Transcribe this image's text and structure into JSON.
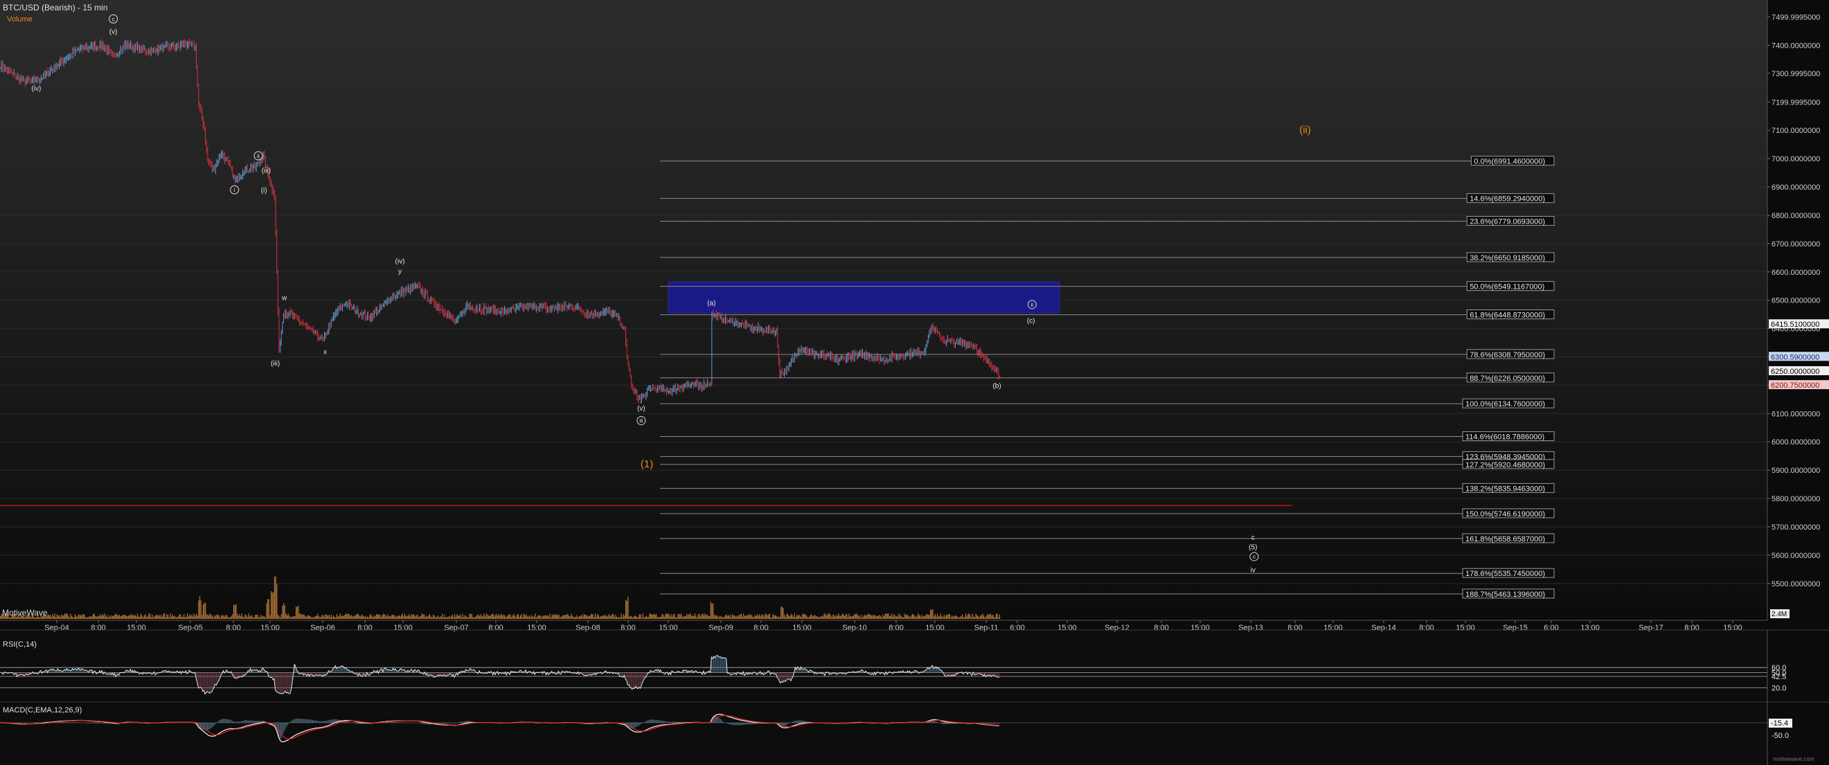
{
  "header": {
    "title": "BTC/USD (Bearish) - 15 min",
    "volume_label": "Volume"
  },
  "branding": {
    "motivewave": "MotiveWave"
  },
  "colors": {
    "background": "#0b0b0b",
    "bg_top": "#2c2c2c",
    "grid": "#2a2a2a",
    "candle_up": "#5fa3d8",
    "candle_down": "#d9323f",
    "fib_line": "#8d8d8d",
    "red_line": "#c41616",
    "box": "#1a1a8c",
    "box_border": "#2a2ab8",
    "orange": "#e8891c",
    "rsi_pos": "#4f7690",
    "rsi_neg": "#7a4450",
    "macd_line": "#e8e8e8",
    "signal_line": "#e02020"
  },
  "chart_data": {
    "type": "candlestick",
    "title": "BTC/USD (Bearish) - 15 min",
    "ylim": [
      5370,
      7560
    ],
    "price_ticks": [
      7499.9995,
      7400,
      7300.9995,
      7199.9995,
      7100,
      7000,
      6900,
      6800,
      6700,
      6600,
      6500,
      6400,
      6300,
      6200,
      6100,
      6000,
      5900,
      5800,
      5700,
      5600,
      5500
    ],
    "price_tick_labels": [
      "7499.9995000",
      "7400.0000000",
      "7300.9995000",
      "7199.9995000",
      "7100.0000000",
      "7000.0000000",
      "6900.0000000",
      "6800.0000000",
      "6700.0000000",
      "6600.0000000",
      "6500.0000000",
      "6400.0000000",
      "6300.0000000",
      "6200.0000000",
      "6100.0000000",
      "6000.0000000",
      "5900.0000000",
      "5800.0000000",
      "5700.0000000",
      "5600.0000000",
      "5500.0000000"
    ],
    "time_ticks": [
      "Sep-04",
      "8:00",
      "15:00",
      "Sep-05",
      "8:00",
      "15:00",
      "Sep-06",
      "8:00",
      "15:00",
      "Sep-07",
      "8:00",
      "15:00",
      "Sep-08",
      "8:00",
      "15:00",
      "Sep-09",
      "8:00",
      "15:00",
      "Sep-10",
      "8:00",
      "15:00",
      "Sep-11",
      "6:00",
      "15:00",
      "Sep-12",
      "8:00",
      "15:00",
      "Sep-13",
      "8:00",
      "15:00",
      "Sep-14",
      "8:00",
      "15:00",
      "Sep-15",
      "6:00",
      "13:00",
      "Sep-17",
      "8:00",
      "15:00"
    ],
    "price_anchors": [
      [
        0,
        7330
      ],
      [
        10,
        7300
      ],
      [
        22,
        7270
      ],
      [
        35,
        7280
      ],
      [
        50,
        7330
      ],
      [
        70,
        7390
      ],
      [
        90,
        7400
      ],
      [
        100,
        7360
      ],
      [
        110,
        7400
      ],
      [
        130,
        7380
      ],
      [
        150,
        7395
      ],
      [
        165,
        7405
      ],
      [
        172,
        7395
      ],
      [
        175,
        7190
      ],
      [
        180,
        7110
      ],
      [
        183,
        6990
      ],
      [
        188,
        6960
      ],
      [
        195,
        7020
      ],
      [
        202,
        6980
      ],
      [
        207,
        6920
      ],
      [
        215,
        6960
      ],
      [
        225,
        6970
      ],
      [
        232,
        7010
      ],
      [
        238,
        6920
      ],
      [
        242,
        6870
      ],
      [
        244,
        6600
      ],
      [
        246,
        6320
      ],
      [
        250,
        6460
      ],
      [
        260,
        6440
      ],
      [
        272,
        6400
      ],
      [
        285,
        6360
      ],
      [
        295,
        6450
      ],
      [
        305,
        6490
      ],
      [
        315,
        6460
      ],
      [
        325,
        6440
      ],
      [
        335,
        6470
      ],
      [
        345,
        6510
      ],
      [
        355,
        6530
      ],
      [
        368,
        6550
      ],
      [
        380,
        6500
      ],
      [
        392,
        6460
      ],
      [
        402,
        6420
      ],
      [
        412,
        6480
      ],
      [
        425,
        6470
      ],
      [
        445,
        6460
      ],
      [
        465,
        6480
      ],
      [
        485,
        6470
      ],
      [
        505,
        6480
      ],
      [
        520,
        6450
      ],
      [
        535,
        6460
      ],
      [
        545,
        6440
      ],
      [
        551,
        6390
      ],
      [
        553,
        6300
      ],
      [
        558,
        6180
      ],
      [
        565,
        6150
      ],
      [
        575,
        6190
      ],
      [
        590,
        6180
      ],
      [
        605,
        6200
      ],
      [
        620,
        6200
      ],
      [
        627,
        6210
      ],
      [
        628,
        6450
      ],
      [
        640,
        6430
      ],
      [
        650,
        6420
      ],
      [
        665,
        6400
      ],
      [
        685,
        6390
      ],
      [
        688,
        6240
      ],
      [
        695,
        6260
      ],
      [
        705,
        6330
      ],
      [
        720,
        6310
      ],
      [
        740,
        6290
      ],
      [
        760,
        6310
      ],
      [
        780,
        6290
      ],
      [
        800,
        6310
      ],
      [
        815,
        6320
      ],
      [
        822,
        6410
      ],
      [
        832,
        6360
      ],
      [
        845,
        6350
      ],
      [
        860,
        6340
      ],
      [
        868,
        6290
      ],
      [
        876,
        6270
      ],
      [
        882,
        6230
      ]
    ],
    "fib_levels": [
      {
        "label": "0.0%(6991.4600000)",
        "value": 6991.46
      },
      {
        "label": "14.6%(6859.2940000)",
        "value": 6859.294
      },
      {
        "label": "23.6%(6779.0693000)",
        "value": 6779.0693
      },
      {
        "label": "38.2%(6650.9185000)",
        "value": 6650.9185
      },
      {
        "label": "50.0%(6549.1167000)",
        "value": 6549.1167
      },
      {
        "label": "61.8%(6448.8730000)",
        "value": 6448.873
      },
      {
        "label": "78.6%(6308.7950000)",
        "value": 6308.795
      },
      {
        "label": "88.7%(6226.0500000)",
        "value": 6226.05
      },
      {
        "label": "100.0%(6134.7600000)",
        "value": 6134.76
      },
      {
        "label": "114.6%(6018.7886000)",
        "value": 6018.7886
      },
      {
        "label": "123.6%(5948.3945000)",
        "value": 5948.3945
      },
      {
        "label": "127.2%(5920.4680000)",
        "value": 5920.468
      },
      {
        "label": "138.2%(5835.9463000)",
        "value": 5835.9463
      },
      {
        "label": "150.0%(5746.6190000)",
        "value": 5746.619
      },
      {
        "label": "161.8%(5658.6587000)",
        "value": 5658.6587
      },
      {
        "label": "178.6%(5535.7450000)",
        "value": 5535.745
      },
      {
        "label": "188.7%(5463.1396000)",
        "value": 5463.1396
      }
    ],
    "price_markers": [
      {
        "label": "6415.5100000",
        "value": 6415.51,
        "style": "white"
      },
      {
        "label": "6300.5900000",
        "value": 6300.59,
        "style": "blue"
      },
      {
        "label": "6250.0000000",
        "value": 6250.0,
        "style": "white"
      },
      {
        "label": "6200.7500000",
        "value": 6200.75,
        "style": "red"
      }
    ],
    "red_line": {
      "value": 5775
    },
    "target_box": {
      "top": 6565,
      "bottom": 6455
    },
    "wave_labels": [
      {
        "text": "(v)",
        "x": 100,
        "price": 7440
      },
      {
        "text": "(iv)",
        "x": 32,
        "price": 7240
      },
      {
        "text": "(iii)",
        "x": 235,
        "price": 6950
      },
      {
        "text": "(i)",
        "x": 233,
        "price": 6880
      },
      {
        "text": "(iii)",
        "x": 243,
        "price": 6270
      },
      {
        "text": "w",
        "x": 251,
        "price": 6500
      },
      {
        "text": "x",
        "x": 287,
        "price": 6310
      },
      {
        "text": "(iv)",
        "x": 353,
        "price": 6630
      },
      {
        "text": "y",
        "x": 353,
        "price": 6595
      },
      {
        "text": "(v)",
        "x": 566,
        "price": 6110
      },
      {
        "text": "(a)",
        "x": 628,
        "price": 6482
      },
      {
        "text": "(c)",
        "x": 910,
        "price": 6420
      },
      {
        "text": "(b)",
        "x": 880,
        "price": 6190
      },
      {
        "text": "c",
        "x": 1106,
        "price": 5655
      },
      {
        "text": "(5)",
        "x": 1106,
        "price": 5620
      },
      {
        "text": "iv",
        "x": 1106,
        "price": 5540
      }
    ],
    "circled_labels": [
      {
        "text": "c",
        "x": 100,
        "price": 7493
      },
      {
        "text": "ii",
        "x": 228,
        "price": 7010
      },
      {
        "text": "i",
        "x": 207,
        "price": 6890
      },
      {
        "text": "iii",
        "x": 566,
        "price": 6075
      },
      {
        "text": "ii",
        "x": 911,
        "price": 6485
      },
      {
        "text": "c",
        "x": 1107,
        "price": 5595
      }
    ],
    "orange_labels": [
      {
        "text": "(ii)",
        "x": 1152,
        "price": 7090
      },
      {
        "text": "(1)",
        "x": 571,
        "price": 5910
      }
    ],
    "volume": {
      "max_label": "2.4M"
    },
    "rsi": {
      "title": "RSI(C,14)",
      "levels": [
        60.0,
        50.0,
        42.5,
        20.0
      ],
      "level_labels": [
        "60.0",
        "50.0",
        "42.5",
        "20.0"
      ]
    },
    "macd": {
      "title": "MACD(C,EMA,12,26,9)",
      "current_label": "-15.4",
      "tick_label": "-50.0"
    }
  },
  "footer": {
    "watermark": "motivewave.com"
  }
}
